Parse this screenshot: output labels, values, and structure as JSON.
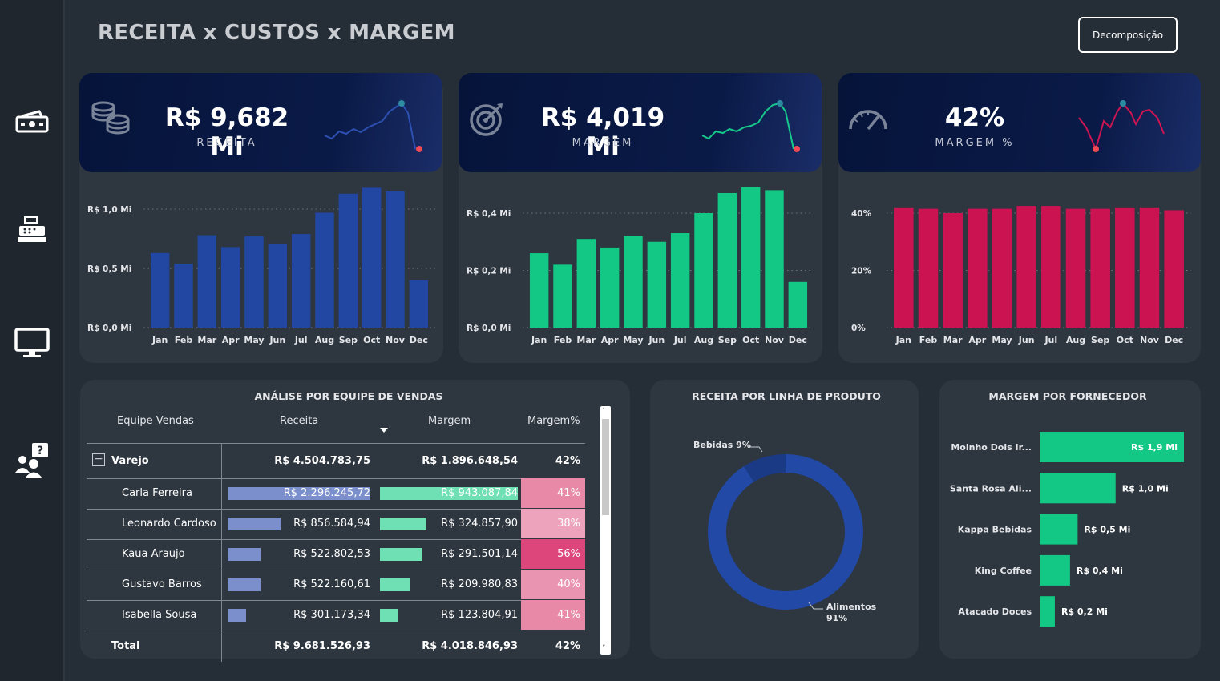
{
  "title": "RECEITA x CUSTOS x MARGEM",
  "decomp_button": "Decomposição",
  "sidebar": {
    "items": [
      {
        "icon": "money-icon"
      },
      {
        "icon": "cash-register-icon"
      },
      {
        "icon": "monitor-icon"
      },
      {
        "icon": "team-question-icon"
      }
    ]
  },
  "kpis": [
    {
      "value": "R$ 9,682 Mi",
      "label": "RECEITA",
      "icon": "coins-icon",
      "color": "#2350b0"
    },
    {
      "value": "R$ 4,019 Mi",
      "label": "MARGEM",
      "icon": "target-icon",
      "color": "#16c98a"
    },
    {
      "value": "42%",
      "label": "MARGEM %",
      "icon": "gauge-icon",
      "color": "#cc1552"
    }
  ],
  "chart_data": [
    {
      "type": "bar",
      "categories": [
        "Jan",
        "Feb",
        "Mar",
        "Apr",
        "May",
        "Jun",
        "Jul",
        "Aug",
        "Sep",
        "Oct",
        "Nov",
        "Dec"
      ],
      "values": [
        0.63,
        0.54,
        0.78,
        0.68,
        0.77,
        0.71,
        0.79,
        0.97,
        1.13,
        1.18,
        1.15,
        0.4
      ],
      "ylim": [
        0,
        1.0
      ],
      "ytick_labels": [
        "R$ 0,0 Mi",
        "R$ 0,5 Mi",
        "R$ 1,0 Mi"
      ],
      "ytick_values": [
        0,
        0.5,
        1.0
      ],
      "color": "#2147a3",
      "grid": true
    },
    {
      "type": "bar",
      "categories": [
        "Jan",
        "Feb",
        "Mar",
        "Apr",
        "May",
        "Jun",
        "Jul",
        "Aug",
        "Sep",
        "Oct",
        "Nov",
        "Dec"
      ],
      "values": [
        0.26,
        0.22,
        0.31,
        0.28,
        0.32,
        0.3,
        0.33,
        0.4,
        0.47,
        0.49,
        0.48,
        0.16
      ],
      "ylim": [
        0,
        0.4
      ],
      "ytick_labels": [
        "R$ 0,0 Mi",
        "R$ 0,2 Mi",
        "R$ 0,4 Mi"
      ],
      "ytick_values": [
        0,
        0.2,
        0.4
      ],
      "color": "#12c884",
      "grid": true
    },
    {
      "type": "bar",
      "categories": [
        "Jan",
        "Feb",
        "Mar",
        "Apr",
        "May",
        "Jun",
        "Jul",
        "Aug",
        "Sep",
        "Oct",
        "Nov",
        "Dec"
      ],
      "values": [
        42,
        41.5,
        40,
        41.5,
        41.5,
        42.5,
        42.5,
        41.5,
        41.5,
        42,
        42,
        41
      ],
      "ylim": [
        0,
        40
      ],
      "ytick_labels": [
        "0%",
        "20%",
        "40%"
      ],
      "ytick_values": [
        0,
        20,
        40
      ],
      "color": "#cc1352",
      "grid": true
    },
    {
      "type": "pie",
      "title": "RECEITA POR LINHA DE PRODUTO",
      "slices": [
        {
          "name": "Bebidas",
          "value": 9,
          "label": "Bebidas 9%",
          "color": "#1a3a86"
        },
        {
          "name": "Alimentos",
          "value": 91,
          "label_line1": "Alimentos",
          "label_line2": "91%",
          "color": "#2149a5"
        }
      ]
    },
    {
      "type": "bar",
      "title": "MARGEM POR FORNECEDOR",
      "categories": [
        "Moinho Dois Ir...",
        "Santa Rosa Ali...",
        "Kappa Bebidas",
        "King Coffee",
        "Atacado Doces"
      ],
      "values": [
        1.9,
        1.0,
        0.5,
        0.4,
        0.2
      ],
      "labels": [
        "R$ 1,9 Mi",
        "R$ 1,0 Mi",
        "R$ 0,5 Mi",
        "R$ 0,4 Mi",
        "R$ 0,2 Mi"
      ],
      "color": "#12c884"
    }
  ],
  "table": {
    "title": "ANÁLISE POR EQUIPE DE VENDAS",
    "headers": [
      "Equipe Vendas",
      "Receita",
      "Margem",
      "Margem%"
    ],
    "group": {
      "name": "Varejo",
      "receita": "R$ 4.504.783,75",
      "margem": "R$ 1.896.648,54",
      "pct": "42%"
    },
    "rows": [
      {
        "name": "Carla Ferreira",
        "receita": "R$ 2.296.245,72",
        "margem": "R$ 943.087,84",
        "pct": "41%",
        "rec_frac": 1.0,
        "mar_frac": 1.0,
        "pct_color": "#e889a8"
      },
      {
        "name": "Leonardo Cardoso",
        "receita": "R$ 856.584,94",
        "margem": "R$ 324.857,90",
        "pct": "38%",
        "rec_frac": 0.37,
        "mar_frac": 0.34,
        "pct_color": "#eea3bc"
      },
      {
        "name": "Kaua Araujo",
        "receita": "R$ 522.802,53",
        "margem": "R$ 291.501,14",
        "pct": "56%",
        "rec_frac": 0.23,
        "mar_frac": 0.31,
        "pct_color": "#dd467b"
      },
      {
        "name": "Gustavo Barros",
        "receita": "R$ 522.160,61",
        "margem": "R$ 209.980,83",
        "pct": "40%",
        "rec_frac": 0.23,
        "mar_frac": 0.22,
        "pct_color": "#e994b0"
      },
      {
        "name": "Isabella Sousa",
        "receita": "R$ 301.173,34",
        "margem": "R$ 123.804,91",
        "pct": "41%",
        "rec_frac": 0.13,
        "mar_frac": 0.13,
        "pct_color": "#e889a8"
      }
    ],
    "total": {
      "name": "Total",
      "receita": "R$ 9.681.526,93",
      "margem": "R$ 4.018.846,93",
      "pct": "42%"
    }
  }
}
